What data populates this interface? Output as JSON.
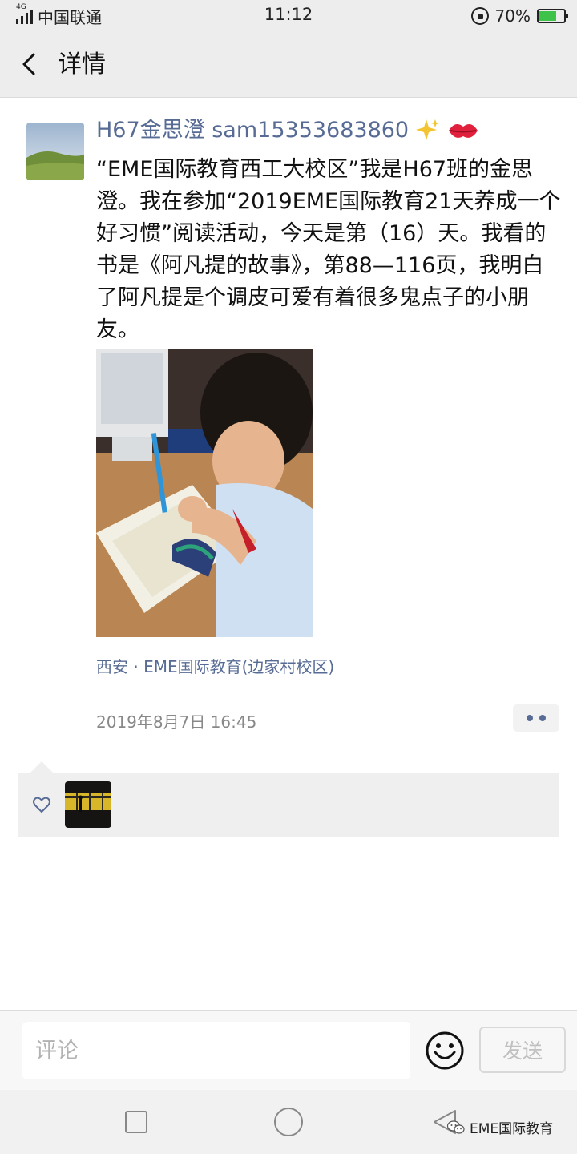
{
  "status_bar": {
    "network": "4G",
    "carrier": "中国联通",
    "time": "11:12",
    "battery_percent": "70%",
    "battery_level": 0.7
  },
  "nav": {
    "title": "详情",
    "back_icon": "chevron-left-icon"
  },
  "post": {
    "author": "H67金思澄 sam15353683860",
    "author_emojis": [
      "sparkles-icon",
      "kiss-mark-icon"
    ],
    "text": "“EME国际教育西工大校区”我是H67班的金思澄。我在参加“2019EME国际教育21天养成一个好习惯”阅读活动，今天是第（16）天。我看的书是《阿凡提的故事》，第88—116页，我明白了阿凡提是个调皮可爱有着很多鬼点子的小朋友。",
    "location": "西安 · EME国际教育(边家村校区)",
    "timestamp": "2019年8月7日 16:45",
    "more_icon": "more-dots-icon"
  },
  "likes": {
    "heart_icon": "heart-outline-icon",
    "count": 1
  },
  "comment_bar": {
    "placeholder": "评论",
    "value": "",
    "emoji_icon": "smiley-icon",
    "send_label": "发送"
  },
  "system_nav": {
    "icons": [
      "recent-apps-icon",
      "home-icon",
      "back-icon"
    ]
  },
  "watermark": {
    "text": "EME国际教育",
    "icon": "wechat-icon"
  },
  "colors": {
    "link": "#576b95",
    "header_bg": "#ededed",
    "likes_bg": "#efefef",
    "battery_green": "#3ec24a"
  }
}
